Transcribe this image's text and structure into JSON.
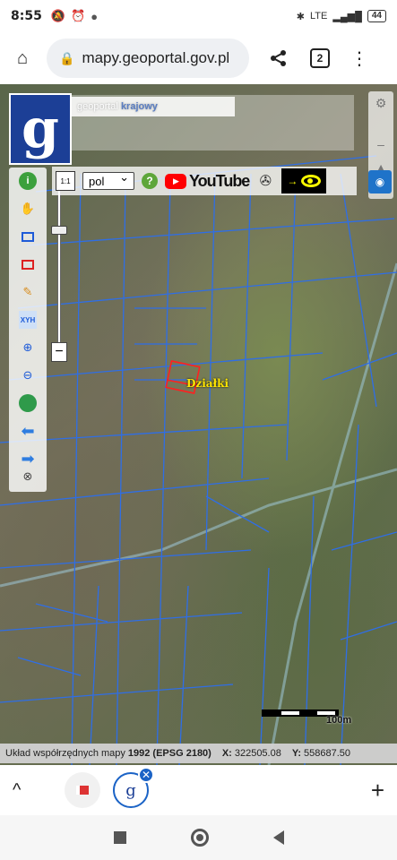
{
  "status_bar": {
    "time": "8:55",
    "network": "LTE",
    "battery": "44"
  },
  "browser": {
    "url": "mapy.geoportal.gov.pl",
    "tab_count": "2"
  },
  "map": {
    "banner_text": "geoportal",
    "banner_bold": "krajowy",
    "logo_letter": "g",
    "language_value": "pol",
    "help_label": "?",
    "youtube_label": "YouTube",
    "parcel_label": "Działki",
    "scale_label": "100m",
    "zoom_minus_label": "−"
  },
  "coord_bar": {
    "system_prefix": "Układ współrzędnych mapy",
    "system_value": "1992 (EPSG 2180)",
    "x_label": "X:",
    "x_value": "322505.08",
    "y_label": "Y:",
    "y_value": "558687.50"
  },
  "icons": {
    "palette": [
      "info-icon",
      "pan-hand-icon",
      "zoom-box-icon",
      "select-box-icon",
      "draw-pencil-icon",
      "xyh-icon",
      "zoom-in-icon",
      "zoom-out-icon",
      "globe-icon",
      "back-arrow-icon",
      "forward-arrow-icon",
      "wheel-icon"
    ]
  }
}
